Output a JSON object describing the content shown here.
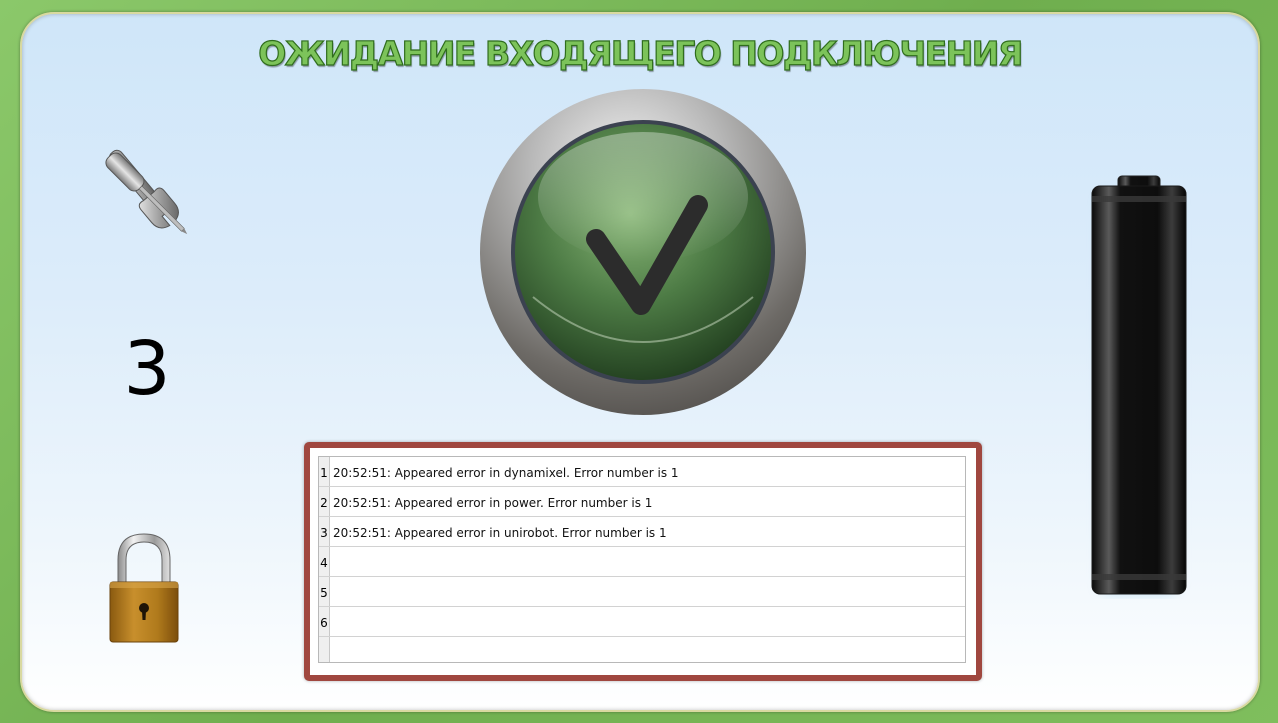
{
  "header": {
    "title": "ОЖИДАНИЕ ВХОДЯЩЕГО ПОДКЛЮЧЕНИЯ"
  },
  "left_panel": {
    "settings_icon": "tools-icon",
    "counter_value": "3",
    "lock_icon": "padlock-icon"
  },
  "status": {
    "icon": "checkmark-icon",
    "state": "connected-ok"
  },
  "battery": {
    "icon": "battery-icon",
    "level": 0
  },
  "log": {
    "rows": [
      {
        "num": "1",
        "text": "20:52:51: Appeared error in dynamixel. Error number is 1"
      },
      {
        "num": "2",
        "text": "20:52:51: Appeared error in power. Error number is 1"
      },
      {
        "num": "3",
        "text": "20:52:51: Appeared error in unirobot. Error number is 1"
      },
      {
        "num": "4",
        "text": ""
      },
      {
        "num": "5",
        "text": ""
      },
      {
        "num": "6",
        "text": ""
      }
    ]
  },
  "colors": {
    "outer_frame": "#7cbe5c",
    "title_fill": "#7cc35a",
    "log_border": "#a0473f"
  }
}
